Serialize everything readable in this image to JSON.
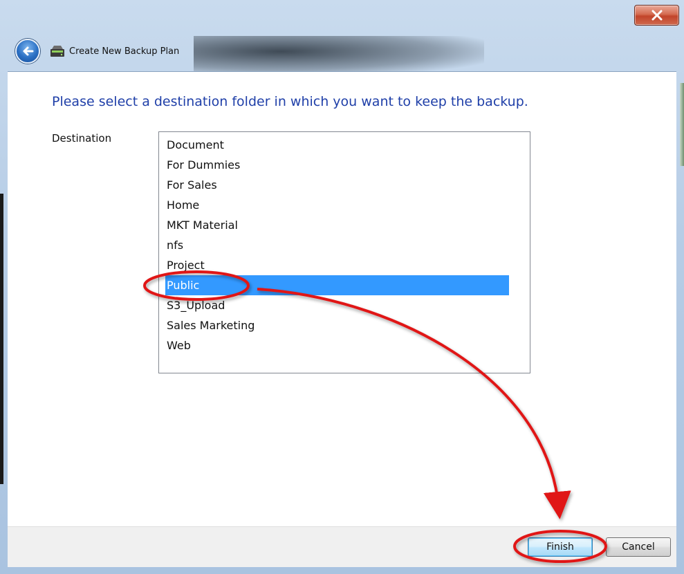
{
  "window": {
    "title": "Create New Backup Plan",
    "close_label": "x"
  },
  "icons": {
    "back": "back-arrow-icon",
    "app": "backup-drive-icon",
    "close": "close-icon"
  },
  "main": {
    "heading": "Please select a destination folder in which you want to keep the backup.",
    "destination_label": "Destination",
    "folders": [
      {
        "label": "Document",
        "selected": false
      },
      {
        "label": "For Dummies",
        "selected": false
      },
      {
        "label": "For Sales",
        "selected": false
      },
      {
        "label": "Home",
        "selected": false
      },
      {
        "label": "MKT Material",
        "selected": false
      },
      {
        "label": "nfs",
        "selected": false
      },
      {
        "label": "Project",
        "selected": false
      },
      {
        "label": "Public",
        "selected": true
      },
      {
        "label": "S3_Upload",
        "selected": false
      },
      {
        "label": "Sales Marketing",
        "selected": false
      },
      {
        "label": "Web",
        "selected": false
      }
    ]
  },
  "footer": {
    "finish_label": "Finish",
    "cancel_label": "Cancel"
  },
  "colors": {
    "heading": "#1f3fa8",
    "selection": "#3399ff",
    "annotation": "#e01818"
  }
}
